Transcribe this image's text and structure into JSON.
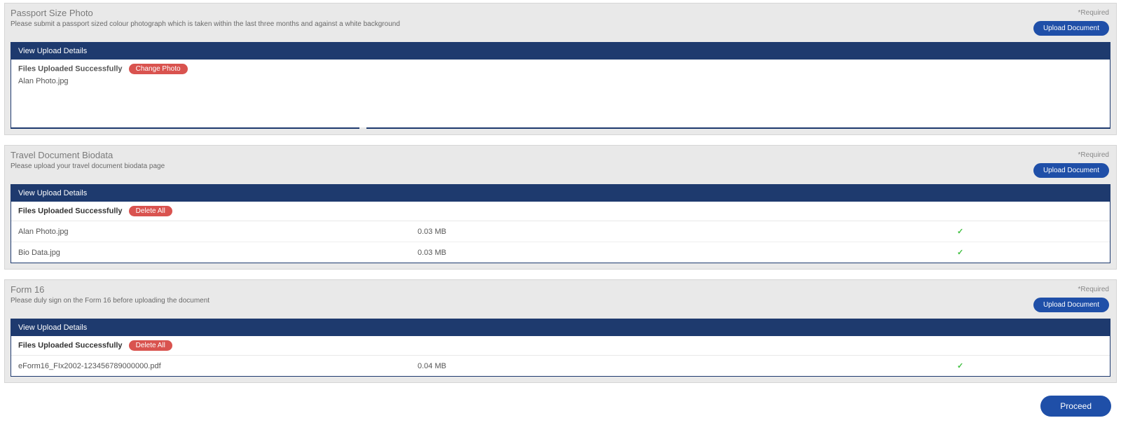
{
  "common": {
    "required_label": "*Required",
    "upload_button": "Upload Document",
    "view_header": "View Upload Details",
    "success_label": "Files Uploaded Successfully",
    "proceed_label": "Proceed"
  },
  "sections": {
    "photo": {
      "title": "Passport Size Photo",
      "desc": "Please submit a passport sized colour photograph which is taken within the last three months and against a white background",
      "action_label": "Change Photo",
      "file_name": "Alan Photo.jpg"
    },
    "biodata": {
      "title": "Travel Document Biodata",
      "desc": "Please upload your travel document biodata page",
      "action_label": "Delete All",
      "files": [
        {
          "name": "Alan Photo.jpg",
          "size": "0.03 MB",
          "status": "ok"
        },
        {
          "name": "Bio Data.jpg",
          "size": "0.03 MB",
          "status": "ok"
        }
      ]
    },
    "form16": {
      "title": "Form 16",
      "desc": "Please duly sign on the Form 16 before uploading the document",
      "action_label": "Delete All",
      "files": [
        {
          "name": "eForm16_FIx2002-123456789000000.pdf",
          "size": "0.04 MB",
          "status": "ok"
        }
      ]
    }
  }
}
